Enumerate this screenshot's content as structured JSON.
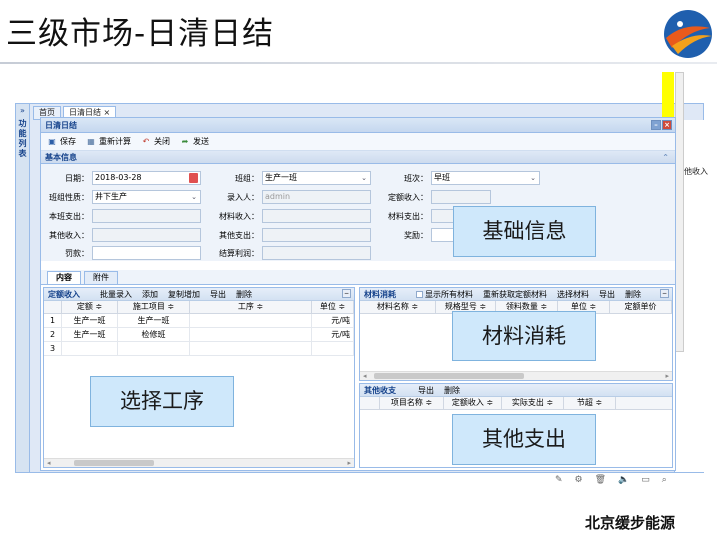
{
  "slide": {
    "title": "三级市场-日清日结",
    "footer": "北京缓步能源"
  },
  "app": {
    "leftbar_label": "功能列表",
    "leftbar_arrow": "»",
    "tabs": [
      {
        "label": "首页"
      },
      {
        "label": "日清日结 ×"
      }
    ],
    "right_label": "其他收入"
  },
  "window": {
    "title": "日清日结",
    "toolbar": {
      "save": "保存",
      "recalc": "重新计算",
      "close": "关闭",
      "send": "发送"
    }
  },
  "basic_info": {
    "header": "基本信息",
    "fields": {
      "date_label": "日期：",
      "date_value": "2018-03-28",
      "group_label": "班组：",
      "group_value": "生产一班",
      "shift_label": "班次：",
      "shift_value": "早班",
      "group_nature_label": "班组性质：",
      "group_nature_value": "井下生产",
      "entered_by_label": "录入人：",
      "entered_by_value": "admin",
      "quota_income_label": "定额收入：",
      "self_expense_label": "本班支出：",
      "material_income_label": "材料收入：",
      "material_expense_label": "材料支出：",
      "other_income_label": "其他收入：",
      "other_expense_label": "其他支出：",
      "bonus_label": "奖励：",
      "penalty_label": "罚款：",
      "settle_profit_label": "结算利润："
    }
  },
  "bottom_tabs": [
    {
      "label": "内容"
    },
    {
      "label": "附件"
    }
  ],
  "quota_pane": {
    "title": "定额收入",
    "actions": [
      "批量录入",
      "添加",
      "复制增加",
      "导出",
      "删除"
    ],
    "columns": [
      "",
      "定额 ≑",
      "施工项目 ≑",
      "工序 ≑",
      "单位 ≑"
    ],
    "rows": [
      {
        "num": "1",
        "quota": "生产一班",
        "project": "生产一班",
        "process": "",
        "unit": "元/吨"
      },
      {
        "num": "2",
        "quota": "生产一班",
        "project": "检修班",
        "process": "",
        "unit": "元/吨"
      },
      {
        "num": "3",
        "quota": "",
        "project": "",
        "process": "",
        "unit": ""
      }
    ]
  },
  "material_pane": {
    "title": "材料消耗",
    "checkbox_label": "显示所有材料",
    "actions": [
      "重新获取定额材料",
      "选择材料",
      "导出",
      "删除"
    ],
    "columns": [
      "材料名称 ≑",
      "规格型号 ≑",
      "领料数量 ≑",
      "单位 ≑",
      "定额单价"
    ]
  },
  "other_pane": {
    "title": "其他收支",
    "actions": [
      "导出",
      "删除"
    ],
    "columns": [
      "项目名称 ≑",
      "定额收入 ≑",
      "实际支出 ≑",
      "节超 ≑"
    ]
  },
  "callouts": {
    "basic": "基础信息",
    "material": "材料消耗",
    "process": "选择工序",
    "other": "其他支出"
  },
  "colors": {
    "accent": "#15428b",
    "border": "#99bbe8",
    "callout_bg": "#cfe8fb"
  }
}
